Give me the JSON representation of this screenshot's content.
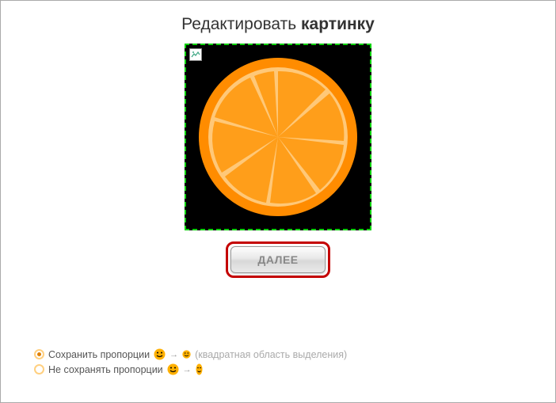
{
  "header": {
    "light": "Редактировать",
    "bold": "картинку"
  },
  "button": {
    "label": "ДАЛЕЕ"
  },
  "options": {
    "keep": "Сохранить пропорции",
    "keep_hint": "(квадратная область выделения)",
    "nokeep": "Не сохранять пропорции",
    "selected": "keep"
  },
  "icons": {
    "broken": "broken-image-icon",
    "smiley_large": "smiley-icon",
    "smiley_small": "smiley-icon",
    "arrow": "→"
  }
}
